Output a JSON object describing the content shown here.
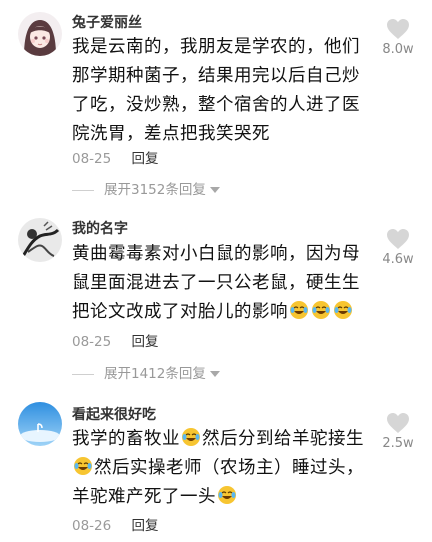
{
  "comments": [
    {
      "username": "兔子爱丽丝",
      "avatar": "anime-girl-avatar",
      "text": "我是云南的，我朋友是学农的，他们那学期种菌子，结果用完以后自己炒了吃，没炒熟，整个宿舍的人进了医院洗胃，差点把我笑哭死",
      "date": "08-25",
      "reply_label": "回复",
      "likes": "8.0w",
      "expand_label": "展开3152条回复"
    },
    {
      "username": "我的名字",
      "avatar": "ink-painting-avatar",
      "text": "黄曲霉毒素对小白鼠的影响，因为母鼠里面混进去了一只公老鼠，硬生生把论文改成了对胎儿的影响",
      "date": "08-25",
      "reply_label": "回复",
      "likes": "4.6w",
      "expand_label": "展开1412条回复"
    },
    {
      "username": "看起来很好吃",
      "avatar": "blue-sky-avatar",
      "text_parts": [
        "我学的畜牧业",
        "然后分到给羊驼接生",
        "然后实操老师（农场主）睡过头，羊驼难产死了一头"
      ],
      "date": "08-26",
      "reply_label": "回复",
      "likes": "2.5w"
    }
  ],
  "colors": {
    "heart": "#d6d6d6",
    "muted": "#9a9a9a"
  }
}
